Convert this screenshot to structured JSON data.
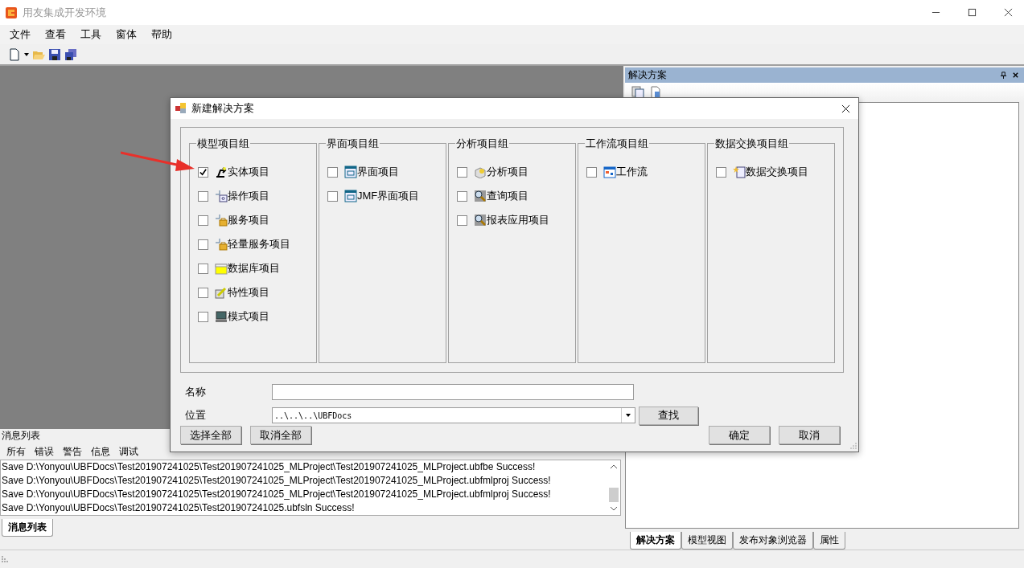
{
  "window": {
    "title": "用友集成开发环境"
  },
  "menu": [
    "文件",
    "查看",
    "工具",
    "窗体",
    "帮助"
  ],
  "solution_panel": {
    "title": "解决方案",
    "tabs": [
      {
        "label": "解决方案",
        "selected": true
      },
      {
        "label": "模型视图",
        "selected": false
      },
      {
        "label": "发布对象浏览器",
        "selected": false
      },
      {
        "label": "属性",
        "selected": false
      }
    ]
  },
  "message_panel": {
    "title": "消息列表",
    "filters": [
      "所有",
      "错误",
      "警告",
      "信息",
      "调试"
    ],
    "lines": [
      "Save D:\\Yonyou\\UBFDocs\\Test201907241025\\Test201907241025_MLProject\\Test201907241025_MLProject.ubfbe Success!",
      "Save D:\\Yonyou\\UBFDocs\\Test201907241025\\Test201907241025_MLProject\\Test201907241025_MLProject.ubfmlproj Success!",
      "Save D:\\Yonyou\\UBFDocs\\Test201907241025\\Test201907241025_MLProject\\Test201907241025_MLProject.ubfmlproj Success!",
      "Save D:\\Yonyou\\UBFDocs\\Test201907241025\\Test201907241025.ubfsln Success!"
    ],
    "tabs": [
      {
        "label": "消息列表",
        "selected": true
      }
    ]
  },
  "dialog": {
    "title": "新建解决方案",
    "groups": [
      {
        "title": "模型项目组",
        "items": [
          {
            "label": "实体项目",
            "checked": true,
            "kind": "entity"
          },
          {
            "label": "操作项目",
            "checked": false,
            "kind": "operation"
          },
          {
            "label": "服务项目",
            "checked": false,
            "kind": "service"
          },
          {
            "label": "轻量服务项目",
            "checked": false,
            "kind": "service"
          },
          {
            "label": "数据库项目",
            "checked": false,
            "kind": "database"
          },
          {
            "label": "特性项目",
            "checked": false,
            "kind": "feature"
          },
          {
            "label": "模式项目",
            "checked": false,
            "kind": "pattern"
          }
        ]
      },
      {
        "title": "界面项目组",
        "items": [
          {
            "label": "界面项目",
            "checked": false,
            "kind": "ui"
          },
          {
            "label": "JMF界面项目",
            "checked": false,
            "kind": "ui"
          }
        ]
      },
      {
        "title": "分析项目组",
        "items": [
          {
            "label": "分析项目",
            "checked": false,
            "kind": "analysis"
          },
          {
            "label": "查询项目",
            "checked": false,
            "kind": "query"
          },
          {
            "label": "报表应用项目",
            "checked": false,
            "kind": "query"
          }
        ]
      },
      {
        "title": "工作流项目组",
        "items": [
          {
            "label": "工作流",
            "checked": false,
            "kind": "workflow"
          }
        ]
      },
      {
        "title": "数据交换项目组",
        "items": [
          {
            "label": "数据交换项目",
            "checked": false,
            "kind": "exchange"
          }
        ]
      }
    ],
    "name_label": "名称",
    "location_label": "位置",
    "location_value": "..\\..\\..\\UBFDocs",
    "browse_button": "查找",
    "select_all": "选择全部",
    "deselect_all": "取消全部",
    "ok": "确定",
    "cancel": "取消"
  }
}
